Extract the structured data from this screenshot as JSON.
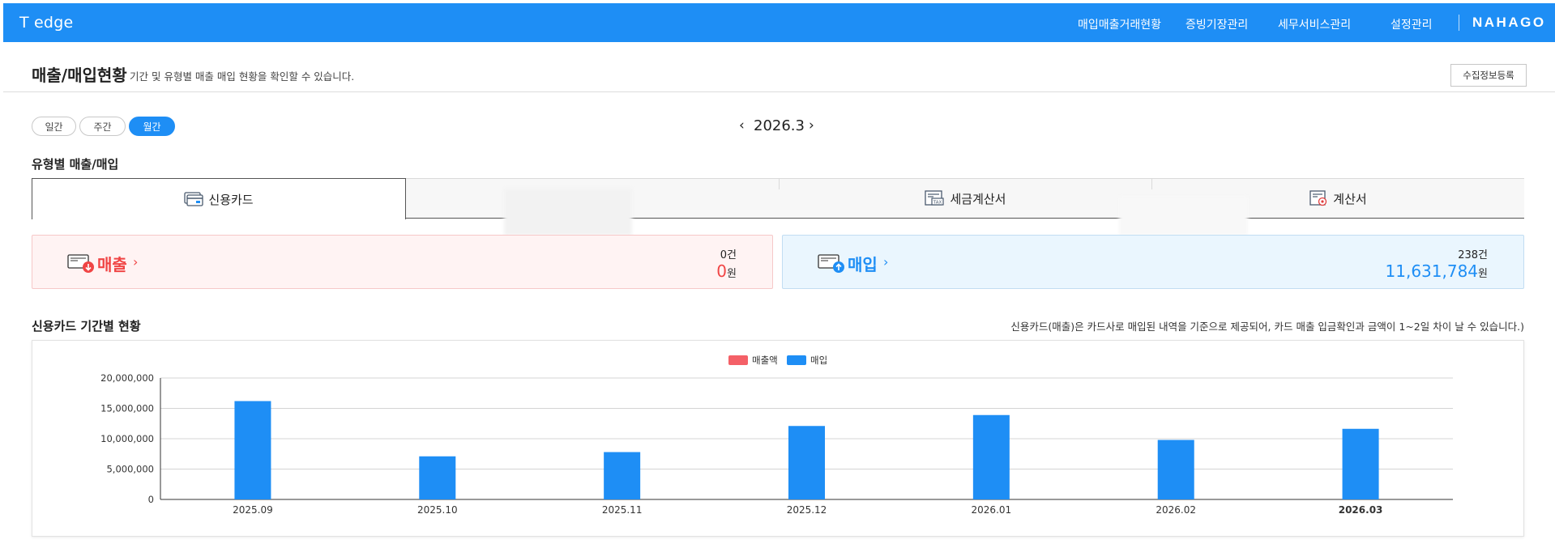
{
  "header": {
    "brand": "T edge",
    "nav": [
      {
        "label": "매입매출거래현황"
      },
      {
        "label": "증빙기장관리"
      },
      {
        "label": "세무서비스관리"
      },
      {
        "label": "설정관리"
      }
    ],
    "logo": "NAHAGO"
  },
  "page": {
    "title": "매출/매입현황",
    "description": "기간 및 유형별 매출 매입 현황을 확인할 수 있습니다.",
    "collect_button": "수집정보등록"
  },
  "period": {
    "options": [
      "일간",
      "주간",
      "월간"
    ],
    "selected": "월간",
    "current": "2026.3",
    "prev_icon": "‹",
    "next_icon": "›"
  },
  "type_section": {
    "title": "유형별 매출/매입",
    "tabs": [
      {
        "label": "신용카드",
        "icon": "credit-card-icon",
        "active": true
      },
      {
        "label": "",
        "icon": "",
        "active": false
      },
      {
        "label": "세금계산서",
        "icon": "tax-invoice-icon",
        "active": false
      },
      {
        "label": "계산서",
        "icon": "invoice-icon",
        "active": false
      }
    ]
  },
  "summary": {
    "sales": {
      "label": "매출",
      "count": "0",
      "count_unit": "건",
      "amount": "0",
      "amount_unit": "원",
      "color": "#f04545"
    },
    "purchase": {
      "label": "매입",
      "count": "238",
      "count_unit": "건",
      "amount": "11,631,784",
      "amount_unit": "원",
      "color": "#1e8ef5"
    }
  },
  "period_section": {
    "title": "신용카드 기간별 현황",
    "note": "신용카드(매출)은 카드사로 매입된 내역을 기준으로 제공되어, 카드 매출 입금확인과 금액이 1~2일 차이 날 수 있습니다.)"
  },
  "chart_data": {
    "type": "bar",
    "categories": [
      "2025.09",
      "2025.10",
      "2025.11",
      "2025.12",
      "2026.01",
      "2026.02",
      "2026.03"
    ],
    "highlight_category": "2026.03",
    "series": [
      {
        "name": "매출액",
        "color": "#f46067",
        "values": [
          0,
          0,
          0,
          0,
          0,
          0,
          0
        ]
      },
      {
        "name": "매입",
        "color": "#1e8ef5",
        "values": [
          16200000,
          7100000,
          7800000,
          12100000,
          13900000,
          9800000,
          11631784
        ]
      }
    ],
    "y_ticks": [
      "0",
      "5,000,000",
      "10,000,000",
      "15,000,000",
      "20,000,000"
    ],
    "ylim": [
      0,
      20000000
    ],
    "grid": true,
    "legend_position": "top-center"
  }
}
